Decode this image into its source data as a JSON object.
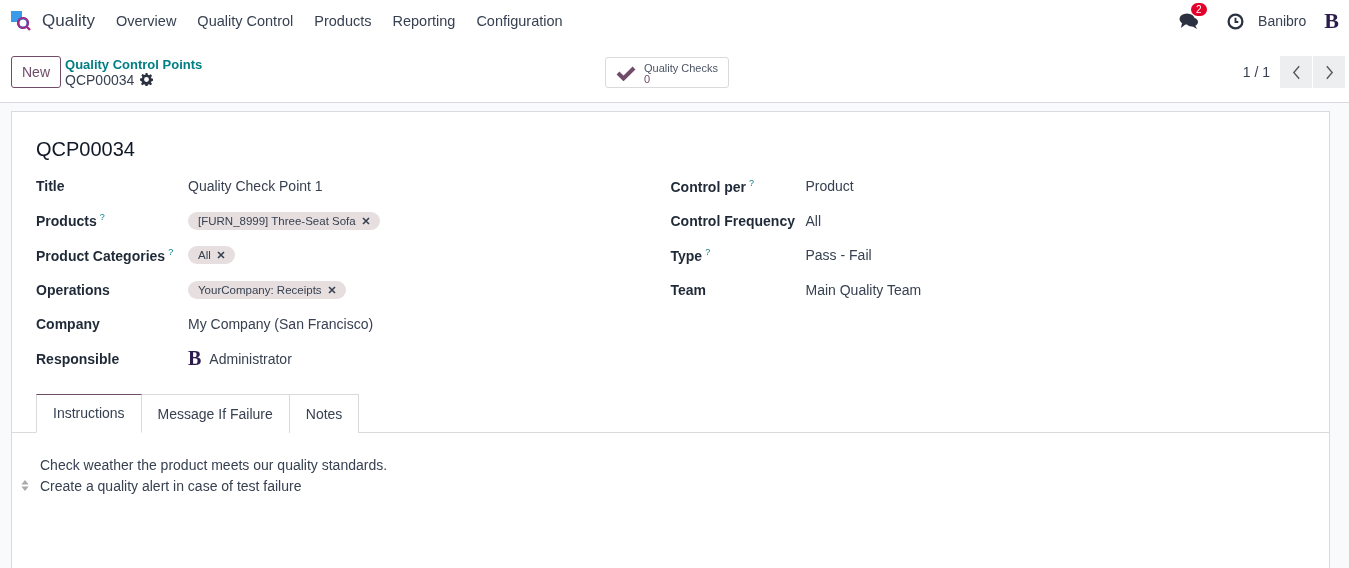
{
  "navbar": {
    "app": "Quality",
    "menu": [
      "Overview",
      "Quality Control",
      "Products",
      "Reporting",
      "Configuration"
    ],
    "messages_badge": "2",
    "user": "Banibro",
    "avatar_letter": "B"
  },
  "control_panel": {
    "new_button": "New",
    "breadcrumb": "Quality Control Points",
    "record": "QCP00034",
    "smart_button": {
      "label": "Quality Checks",
      "count": "0"
    },
    "pager": "1 / 1"
  },
  "form": {
    "name": "QCP00034",
    "left_fields": [
      {
        "label": "Title",
        "kind": "text",
        "value": "Quality Check Point 1"
      },
      {
        "label": "Products",
        "help": "?",
        "kind": "tags",
        "tags": [
          "[FURN_8999] Three-Seat Sofa"
        ]
      },
      {
        "label": "Product Categories",
        "help": "?",
        "kind": "tags",
        "tags": [
          "All"
        ]
      },
      {
        "label": "Operations",
        "kind": "tags",
        "tags": [
          "YourCompany: Receipts"
        ]
      },
      {
        "label": "Company",
        "kind": "text",
        "value": "My Company (San Francisco)"
      },
      {
        "label": "Responsible",
        "kind": "user",
        "avatar_letter": "B",
        "value": "Administrator"
      }
    ],
    "right_fields": [
      {
        "label": "Control per",
        "help": "?",
        "kind": "text",
        "value": "Product"
      },
      {
        "label": "Control Frequency",
        "kind": "text",
        "value": "All"
      },
      {
        "label": "Type",
        "help": "?",
        "kind": "text",
        "value": "Pass - Fail"
      },
      {
        "label": "Team",
        "kind": "text",
        "value": "Main Quality Team"
      }
    ],
    "tabs": [
      {
        "label": "Instructions",
        "selected": true
      },
      {
        "label": "Message If Failure",
        "selected": false
      },
      {
        "label": "Notes",
        "selected": false
      }
    ],
    "instructions": [
      "Check weather the product meets our quality standards.",
      "Create a quality alert in case of test failure"
    ]
  }
}
